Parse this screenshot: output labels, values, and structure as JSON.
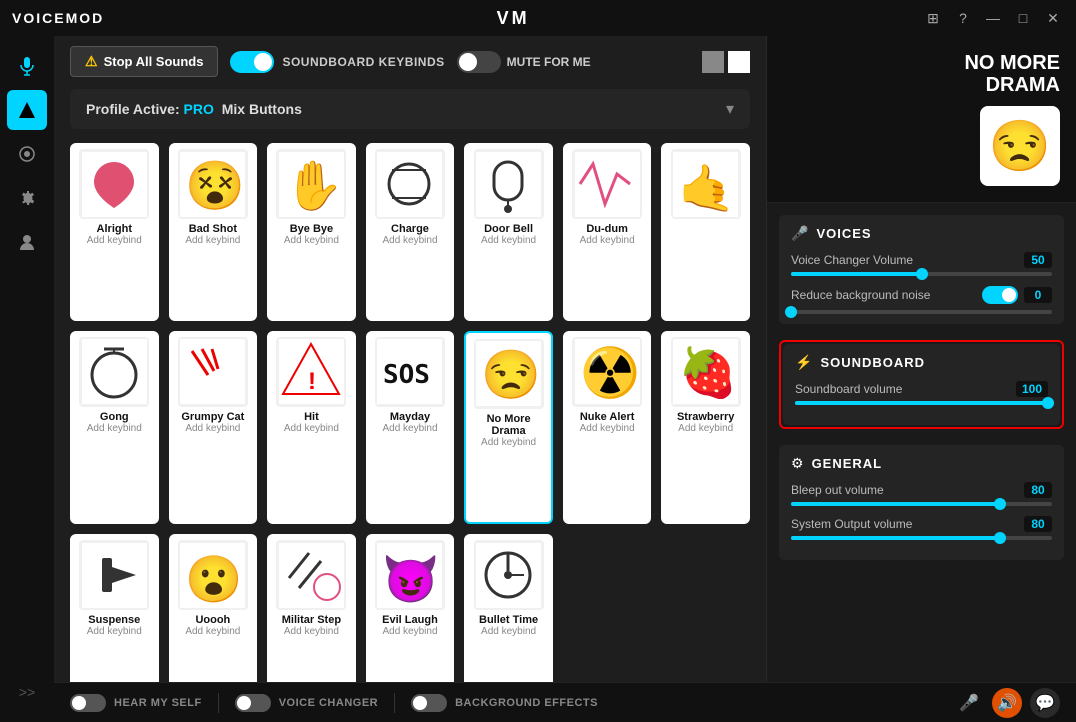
{
  "app": {
    "name": "VOICEMOD",
    "logo_symbol": "VM"
  },
  "titlebar": {
    "help_label": "?",
    "minimize_label": "—",
    "maximize_label": "□",
    "close_label": "✕"
  },
  "sidebar": {
    "mic_icon": "🎤",
    "soundboard_icon": "⚡",
    "effects_icon": "🧪",
    "settings_icon": "⚙",
    "user_icon": "👤",
    "expand_icon": ">>"
  },
  "toolbar": {
    "stop_sounds_label": "Stop All Sounds",
    "soundboard_keybinds_label": "SOUNDBOARD KEYBINDS",
    "mute_for_me_label": "MUTE FOR ME",
    "soundboard_keybinds_on": true,
    "mute_for_me_on": false
  },
  "profile": {
    "prefix": "Profile Active:",
    "pro_badge": "PRO",
    "name": "Mix Buttons"
  },
  "sounds": [
    {
      "id": "alright",
      "name": "Alright",
      "keybind": "Add keybind",
      "emoji": "❤️",
      "bg": "#fff",
      "active": false
    },
    {
      "id": "bad_shot",
      "name": "Bad Shot",
      "keybind": "Add keybind",
      "emoji": "😵",
      "bg": "#fff",
      "active": false
    },
    {
      "id": "bye_bye",
      "name": "Bye Bye",
      "keybind": "Add keybind",
      "emoji": "✋",
      "bg": "#fff",
      "active": false
    },
    {
      "id": "charge",
      "name": "Charge",
      "keybind": "Add keybind",
      "emoji": "⚾",
      "bg": "#fff",
      "active": false
    },
    {
      "id": "door_bell",
      "name": "Door Bell",
      "keybind": "Add keybind",
      "emoji": "🔔",
      "bg": "#fff",
      "active": false
    },
    {
      "id": "du_dum",
      "name": "Du-dum",
      "keybind": "Add keybind",
      "emoji": "💓",
      "bg": "#fff",
      "active": false
    },
    {
      "id": "hand2",
      "name": "",
      "keybind": "",
      "emoji": "🤙",
      "bg": "#fff",
      "active": false
    },
    {
      "id": "gong",
      "name": "Gong",
      "keybind": "Add keybind",
      "emoji": "🔔",
      "bg": "#fff",
      "active": false
    },
    {
      "id": "grumpy_cat",
      "name": "Grumpy Cat",
      "keybind": "Add keybind",
      "emoji": "😾",
      "bg": "#fff",
      "active": false
    },
    {
      "id": "hit",
      "name": "Hit",
      "keybind": "Add keybind",
      "emoji": "⚠️",
      "bg": "#fff",
      "active": false
    },
    {
      "id": "mayday",
      "name": "Mayday",
      "keybind": "Add keybind",
      "emoji": "🆘",
      "bg": "#fff",
      "active": false
    },
    {
      "id": "no_more_drama",
      "name": "No More Drama",
      "keybind": "Add keybind",
      "emoji": "😒",
      "bg": "#fff",
      "active": true
    },
    {
      "id": "nuke_alert",
      "name": "Nuke Alert",
      "keybind": "Add keybind",
      "emoji": "☢️",
      "bg": "#fff",
      "active": false
    },
    {
      "id": "strawberry",
      "name": "Strawberry",
      "keybind": "Add keybind",
      "emoji": "🍓",
      "bg": "#fff",
      "active": false
    },
    {
      "id": "suspense",
      "name": "Suspense",
      "keybind": "Add keybind",
      "emoji": "🔨",
      "bg": "#fff",
      "active": false
    },
    {
      "id": "uoooh",
      "name": "Uoooh",
      "keybind": "Add keybind",
      "emoji": "😮",
      "bg": "#fff",
      "active": false
    },
    {
      "id": "militar_step",
      "name": "Militar Step",
      "keybind": "Add keybind",
      "emoji": "🥁",
      "bg": "#fff",
      "active": false
    },
    {
      "id": "evil_laugh",
      "name": "Evil Laugh",
      "keybind": "Add keybind",
      "emoji": "😈",
      "bg": "#fff",
      "active": false
    },
    {
      "id": "bullet_time",
      "name": "Bullet Time",
      "keybind": "Add keybind",
      "emoji": "⏱️",
      "bg": "#fff",
      "active": false
    }
  ],
  "active_sound": {
    "title": "NO MORE\nDRAMA",
    "emoji": "😒"
  },
  "voices_section": {
    "title": "VOICES",
    "voice_changer_volume_label": "Voice Changer Volume",
    "voice_changer_volume_value": "50",
    "voice_changer_volume_pct": 50,
    "reduce_bg_noise_label": "Reduce background noise",
    "reduce_bg_noise_value": "0",
    "reduce_bg_noise_on": true
  },
  "soundboard_section": {
    "title": "SOUNDBOARD",
    "soundboard_volume_label": "Soundboard volume",
    "soundboard_volume_value": "100",
    "soundboard_volume_pct": 100
  },
  "general_section": {
    "title": "GENERAL",
    "bleep_out_label": "Bleep out volume",
    "bleep_out_value": "80",
    "bleep_out_pct": 80,
    "system_output_label": "System Output volume",
    "system_output_value": "80",
    "system_output_pct": 80
  },
  "bottom_bar": {
    "hear_myself_label": "HEAR MY SELF",
    "hear_myself_on": false,
    "voice_changer_label": "VOICE CHANGER",
    "voice_changer_on": false,
    "background_effects_label": "BACKGROUND EFFECTS",
    "background_effects_on": false,
    "mic_icon": "🎤",
    "volume_icon": "🔊",
    "chat_icon": "💬"
  }
}
